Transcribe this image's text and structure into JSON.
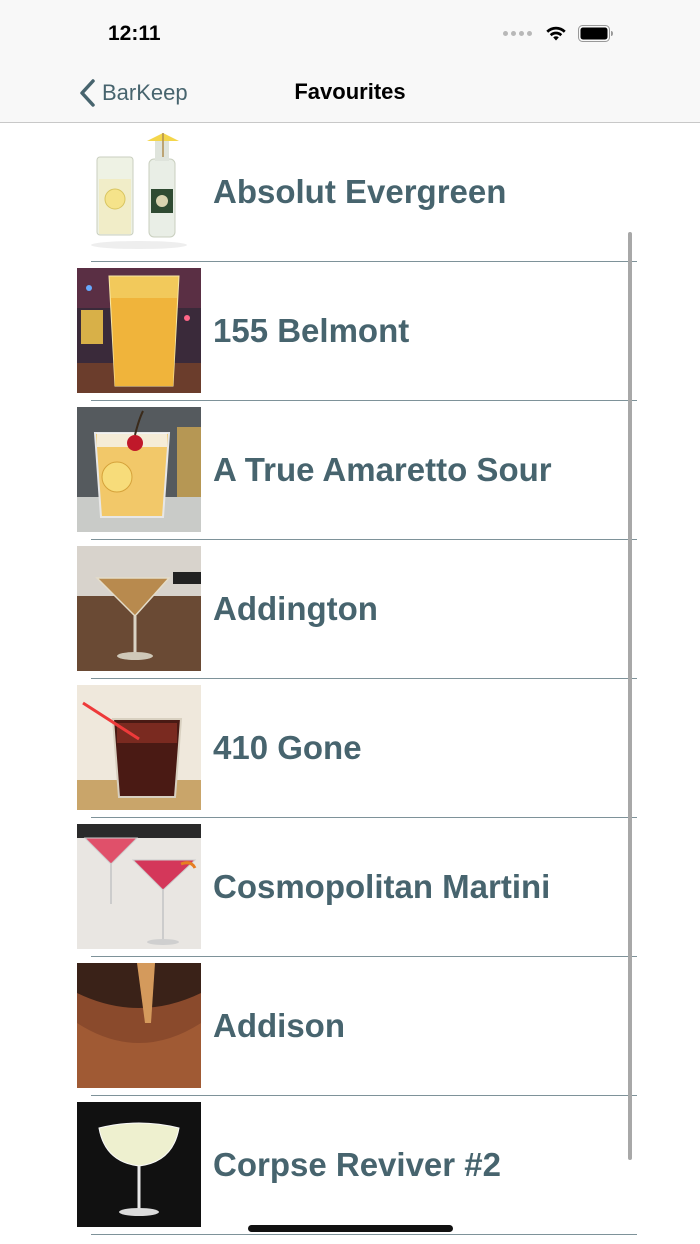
{
  "status_bar": {
    "time": "12:11"
  },
  "nav": {
    "back_label": "BarKeep",
    "title": "Favourites"
  },
  "favourites": [
    {
      "name": "Absolut Evergreen"
    },
    {
      "name": "155 Belmont"
    },
    {
      "name": "A True Amaretto Sour"
    },
    {
      "name": "Addington"
    },
    {
      "name": "410 Gone"
    },
    {
      "name": "Cosmopolitan Martini"
    },
    {
      "name": "Addison"
    },
    {
      "name": "Corpse Reviver #2"
    }
  ],
  "colors": {
    "accent": "#47646e",
    "nav_background": "#f8f8f8"
  }
}
